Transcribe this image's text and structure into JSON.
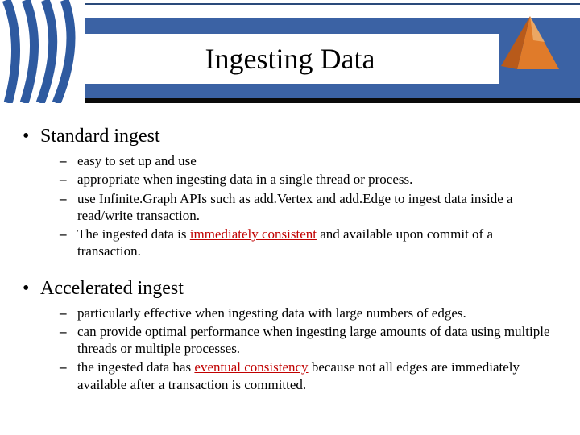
{
  "title": "Ingesting Data",
  "sections": [
    {
      "heading": "Standard ingest",
      "items": [
        {
          "parts": [
            {
              "t": "easy to set up and use"
            }
          ]
        },
        {
          "parts": [
            {
              "t": "appropriate when ingesting data in a single thread or process."
            }
          ]
        },
        {
          "parts": [
            {
              "t": "use Infinite.Graph APIs such as add.Vertex and add.Edge to ingest data inside a read/write transaction."
            }
          ]
        },
        {
          "parts": [
            {
              "t": "The ingested data is "
            },
            {
              "t": "immediately consistent",
              "red": true,
              "underline": true
            },
            {
              "t": " and available upon commit of a transaction."
            }
          ]
        }
      ]
    },
    {
      "heading": "Accelerated ingest",
      "items": [
        {
          "parts": [
            {
              "t": "particularly effective when ingesting data with large numbers of edges."
            }
          ]
        },
        {
          "parts": [
            {
              "t": "can provide optimal performance when ingesting large amounts of data using multiple threads or multiple processes."
            }
          ]
        },
        {
          "parts": [
            {
              "t": "the ingested data has "
            },
            {
              "t": "eventual consistency",
              "red": true,
              "underline": true
            },
            {
              "t": " because not all edges are immediately available after a transaction is committed."
            }
          ]
        }
      ]
    }
  ]
}
